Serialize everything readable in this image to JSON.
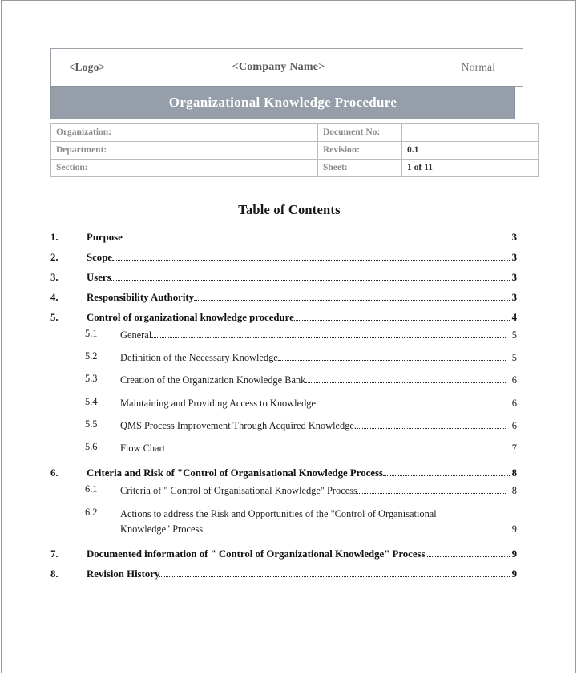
{
  "document": {
    "header": {
      "logo_placeholder": "<Logo>",
      "company_placeholder": "<Company Name>",
      "classification": "Normal"
    },
    "title": "Organizational Knowledge Procedure",
    "info": {
      "rows": [
        {
          "label_left": "Organization:",
          "value_left": "",
          "label_right": "Document No:",
          "value_right": ""
        },
        {
          "label_left": "Department:",
          "value_left": "",
          "label_right": "Revision:",
          "value_right": "0.1"
        },
        {
          "label_left": "Section:",
          "value_left": "",
          "label_right": "Sheet:",
          "value_right": "1 of 11"
        }
      ]
    },
    "toc": {
      "heading": "Table of Contents",
      "entries": [
        {
          "number": "1.",
          "title": "Purpose",
          "page": "3",
          "level": 1
        },
        {
          "number": "2.",
          "title": "Scope",
          "page": "3",
          "level": 1
        },
        {
          "number": "3.",
          "title": "Users",
          "page": "3",
          "level": 1
        },
        {
          "number": "4.",
          "title": "Responsibility Authority",
          "page": "3",
          "level": 1
        },
        {
          "number": "5.",
          "title": "Control of organizational knowledge procedure",
          "page": "4",
          "level": 1
        },
        {
          "number": "5.1",
          "title": "General",
          "page": "5",
          "level": 2
        },
        {
          "number": "5.2",
          "title": "Definition of the Necessary Knowledge",
          "page": "5",
          "level": 2
        },
        {
          "number": "5.3",
          "title": "Creation of the Organization Knowledge Bank",
          "page": "6",
          "level": 2
        },
        {
          "number": "5.4",
          "title": "Maintaining and Providing Access to Knowledge",
          "page": "6",
          "level": 2
        },
        {
          "number": "5.5",
          "title": "QMS Process Improvement Through Acquired Knowledge.",
          "page": "6",
          "level": 2
        },
        {
          "number": "5.6",
          "title": "Flow Chart",
          "page": "7",
          "level": 2
        },
        {
          "number": "6.",
          "title": "Criteria and Risk of \"Control of Organisational Knowledge Process",
          "page": "8",
          "level": 1
        },
        {
          "number": "6.1",
          "title": "Criteria of \" Control of Organisational Knowledge\" Process",
          "page": "8",
          "level": 2
        },
        {
          "number": "6.2",
          "title_line1": "Actions to address the Risk and Opportunities of the \"Control of Organisational",
          "title_line2": "Knowledge\" Process",
          "page": "9",
          "level": 2,
          "wrapped": true
        },
        {
          "number": "7.",
          "title": "Documented information of \" Control of Organizational Knowledge\" Process",
          "page": "9",
          "level": 1
        },
        {
          "number": "8.",
          "title": "Revision History",
          "page": "9",
          "level": 1
        }
      ]
    },
    "colors": {
      "title_bar_background": "#959ea9",
      "title_bar_text": "#ffffff",
      "header_border": "#9aa0a8",
      "info_label_text": "#8a8d91",
      "info_value_text": "#2f2f2f",
      "page_border": "#9a9a9a"
    }
  }
}
